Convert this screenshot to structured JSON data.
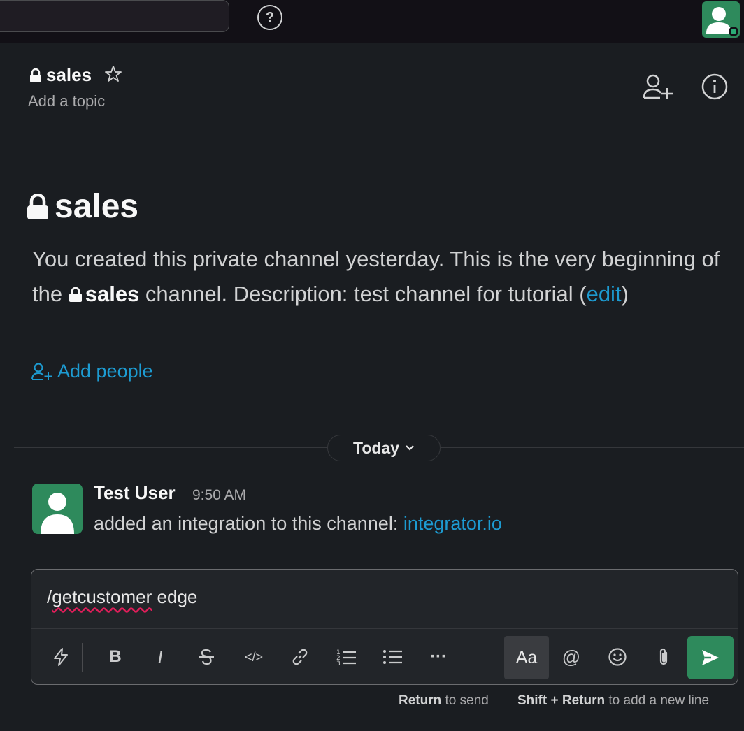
{
  "topbar": {
    "help_icon": "?"
  },
  "header": {
    "channel_name": "sales",
    "topic_placeholder": "Add a topic"
  },
  "intro": {
    "title": "sales",
    "desc_part1": "You created this private channel yesterday. This is the very beginning of the ",
    "desc_channel": "sales",
    "desc_part2": " channel. Description: test channel for tutorial (",
    "desc_edit": "edit",
    "desc_part3": ")",
    "add_people": "Add people"
  },
  "divider": {
    "label": "Today"
  },
  "message": {
    "author": "Test User",
    "time": "9:50 AM",
    "text": "added an integration to this channel: ",
    "link": "integrator.io"
  },
  "composer": {
    "input_spell": "getcustomer",
    "input_rest": " edge",
    "input_prefix": "/",
    "toolbar": {
      "bold": "B",
      "italic": "I",
      "code": "</>",
      "more": "···",
      "format": "Aa",
      "mention": "@"
    }
  },
  "hints": {
    "return_key": "Return",
    "return_text": " to send",
    "shift_key": "Shift + Return",
    "shift_text": " to add a new line"
  },
  "colors": {
    "accent_green": "#2e8a5c",
    "link_blue": "#1d9bd1",
    "background": "#1a1d21"
  }
}
